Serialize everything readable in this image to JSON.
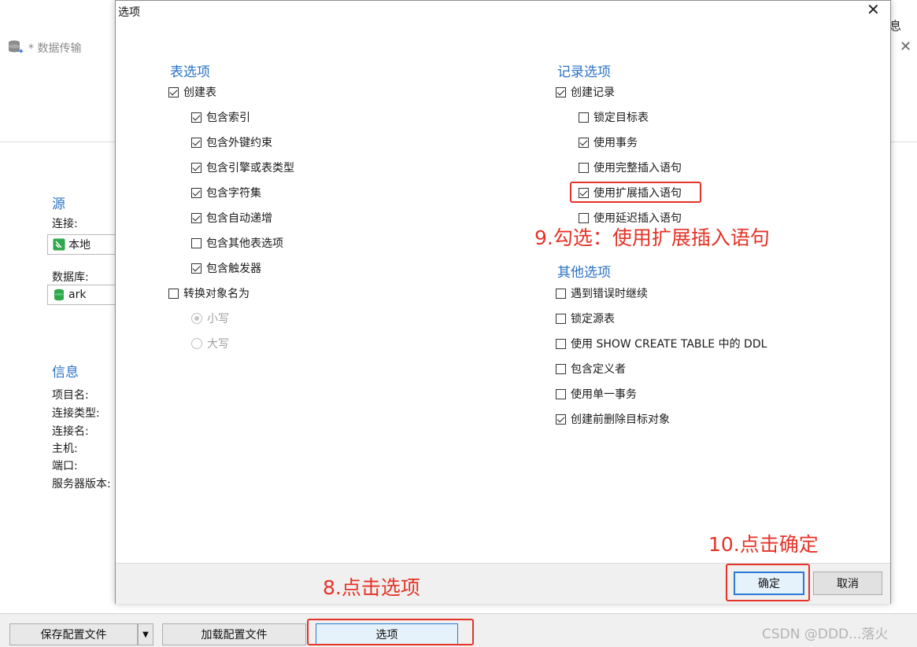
{
  "background": {
    "window_title": "* 数据传输",
    "top_right_text": "息",
    "source": {
      "section_title": "源",
      "connection_label": "连接:",
      "connection_value": "本地",
      "database_label": "数据库:",
      "database_value": "ark"
    },
    "info": {
      "section_title": "信息",
      "labels": [
        "项目名:",
        "连接类型:",
        "连接名:",
        "主机:",
        "端口:",
        "服务器版本:"
      ]
    },
    "bottom_buttons": {
      "save_config": "保存配置文件",
      "load_config": "加载配置文件",
      "options": "选项"
    }
  },
  "dialog": {
    "title": "选项",
    "table_options": {
      "title": "表选项",
      "create_table": {
        "label": "创建表",
        "checked": true
      },
      "sub_options": [
        {
          "label": "包含索引",
          "checked": true
        },
        {
          "label": "包含外键约束",
          "checked": true
        },
        {
          "label": "包含引擎或表类型",
          "checked": true
        },
        {
          "label": "包含字符集",
          "checked": true
        },
        {
          "label": "包含自动递增",
          "checked": true
        },
        {
          "label": "包含其他表选项",
          "checked": false
        },
        {
          "label": "包含触发器",
          "checked": true
        }
      ],
      "convert_names": {
        "label": "转换对象名为",
        "checked": false
      },
      "case_options": [
        {
          "label": "小写",
          "selected": true
        },
        {
          "label": "大写",
          "selected": false
        }
      ]
    },
    "record_options": {
      "title": "记录选项",
      "create_records": {
        "label": "创建记录",
        "checked": true
      },
      "sub_options": [
        {
          "label": "锁定目标表",
          "checked": false
        },
        {
          "label": "使用事务",
          "checked": true
        },
        {
          "label": "使用完整插入语句",
          "checked": false
        },
        {
          "label": "使用扩展插入语句",
          "checked": true
        },
        {
          "label": "使用延迟插入语句",
          "checked": false
        }
      ]
    },
    "other_options": {
      "title": "其他选项",
      "items": [
        {
          "label": "遇到错误时继续",
          "checked": false
        },
        {
          "label": "锁定源表",
          "checked": false
        },
        {
          "label": "使用 SHOW CREATE TABLE 中的 DDL",
          "checked": false
        },
        {
          "label": "包含定义者",
          "checked": false
        },
        {
          "label": "使用单一事务",
          "checked": false
        },
        {
          "label": "创建前删除目标对象",
          "checked": true
        }
      ]
    },
    "ok_label": "确定",
    "cancel_label": "取消"
  },
  "annotations": {
    "step8": "8.点击选项",
    "step9": "9.勾选：使用扩展插入语句",
    "step10": "10.点击确定",
    "accent_color": "#e53327"
  },
  "watermark": "CSDN @DDD...落火"
}
